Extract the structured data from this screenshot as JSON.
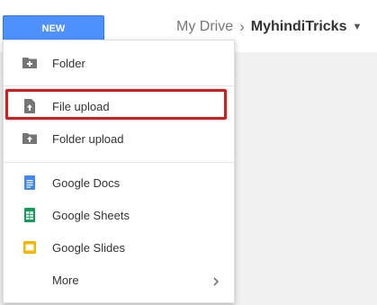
{
  "toolbar": {
    "new_label": "NEW"
  },
  "breadcrumb": {
    "root": "My Drive",
    "separator": "›",
    "current": "MyhindiTricks",
    "caret": "▼"
  },
  "menu": {
    "folder": {
      "label": "Folder",
      "icon": "folder-plus-icon"
    },
    "file_upload": {
      "label": "File upload",
      "icon": "file-upload-icon"
    },
    "folder_upload": {
      "label": "Folder upload",
      "icon": "folder-upload-icon"
    },
    "google_docs": {
      "label": "Google Docs",
      "icon": "google-docs-icon",
      "color": "#4285f4"
    },
    "google_sheets": {
      "label": "Google Sheets",
      "icon": "google-sheets-icon",
      "color": "#0f9d58"
    },
    "google_slides": {
      "label": "Google Slides",
      "icon": "google-slides-icon",
      "color": "#f4b400"
    },
    "more": {
      "label": "More",
      "icon": "chevron-right-icon"
    }
  },
  "colors": {
    "accent": "#4d90fe",
    "highlight": "#cc1f1f"
  }
}
